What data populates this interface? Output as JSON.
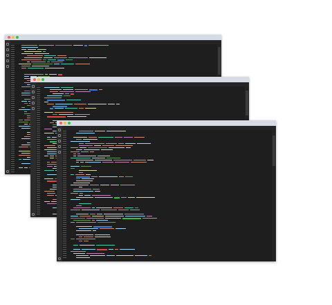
{
  "windows": [
    {
      "name": "editor-window-back",
      "tab_label": "",
      "lines": 60
    },
    {
      "name": "editor-window-middle",
      "tab_label": "",
      "lines": 60
    },
    {
      "name": "editor-window-front",
      "tab_label": "",
      "lines": 60
    }
  ],
  "colors": {
    "background": "#ffffff",
    "editor_bg": "#1e1e1e",
    "titlebar": "#d6dbe6",
    "keyword": "#c586c0",
    "string": "#ce9178",
    "comment": "#6a9955",
    "function": "#dcdcaa",
    "variable": "#9cdcfe",
    "type": "#4ec9b0",
    "highlight_red": "#e04848",
    "highlight_blue": "#3c7fd8",
    "highlight_green": "#2fbf4f",
    "plain": "#d4d4d4"
  },
  "icons": [
    "files-icon",
    "search-icon",
    "source-control-icon",
    "debug-icon",
    "extensions-icon",
    "settings-gear-icon"
  ]
}
